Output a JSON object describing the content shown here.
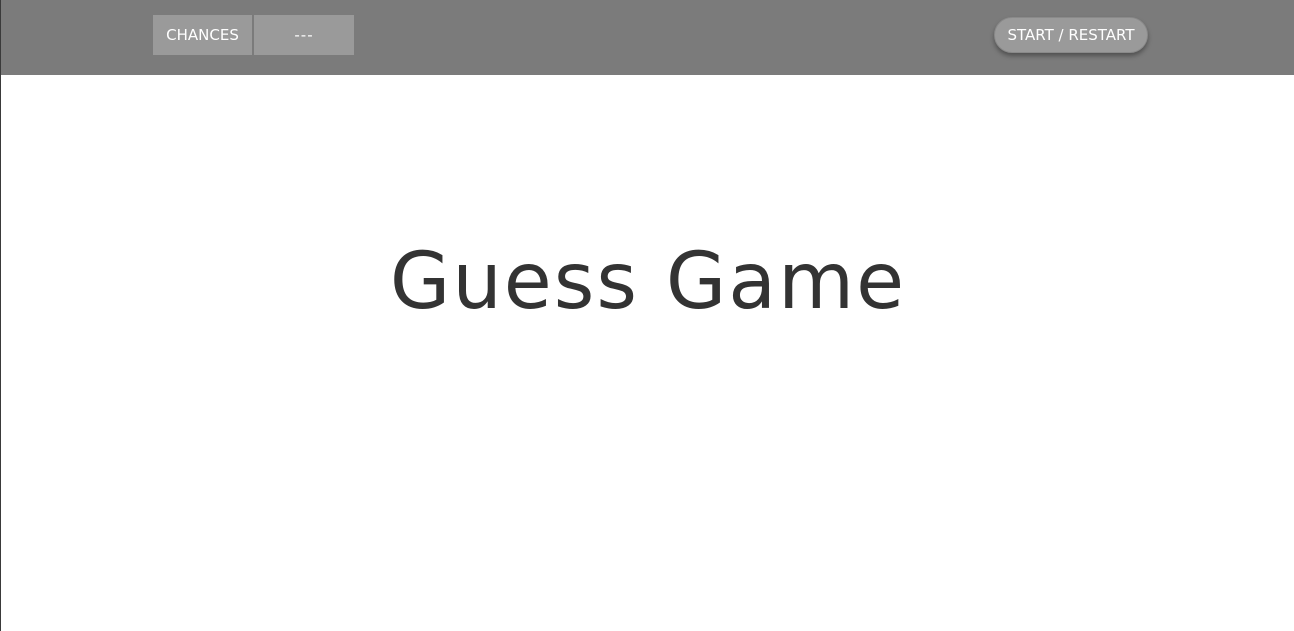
{
  "header": {
    "chances_label": "CHANCES",
    "chances_value": "---",
    "restart_label": "START / RESTART"
  },
  "main": {
    "title": "Guess Game"
  },
  "colors": {
    "topbar": "#7b7b7b",
    "chip": "#9a9a9a",
    "title_text": "#333333"
  }
}
